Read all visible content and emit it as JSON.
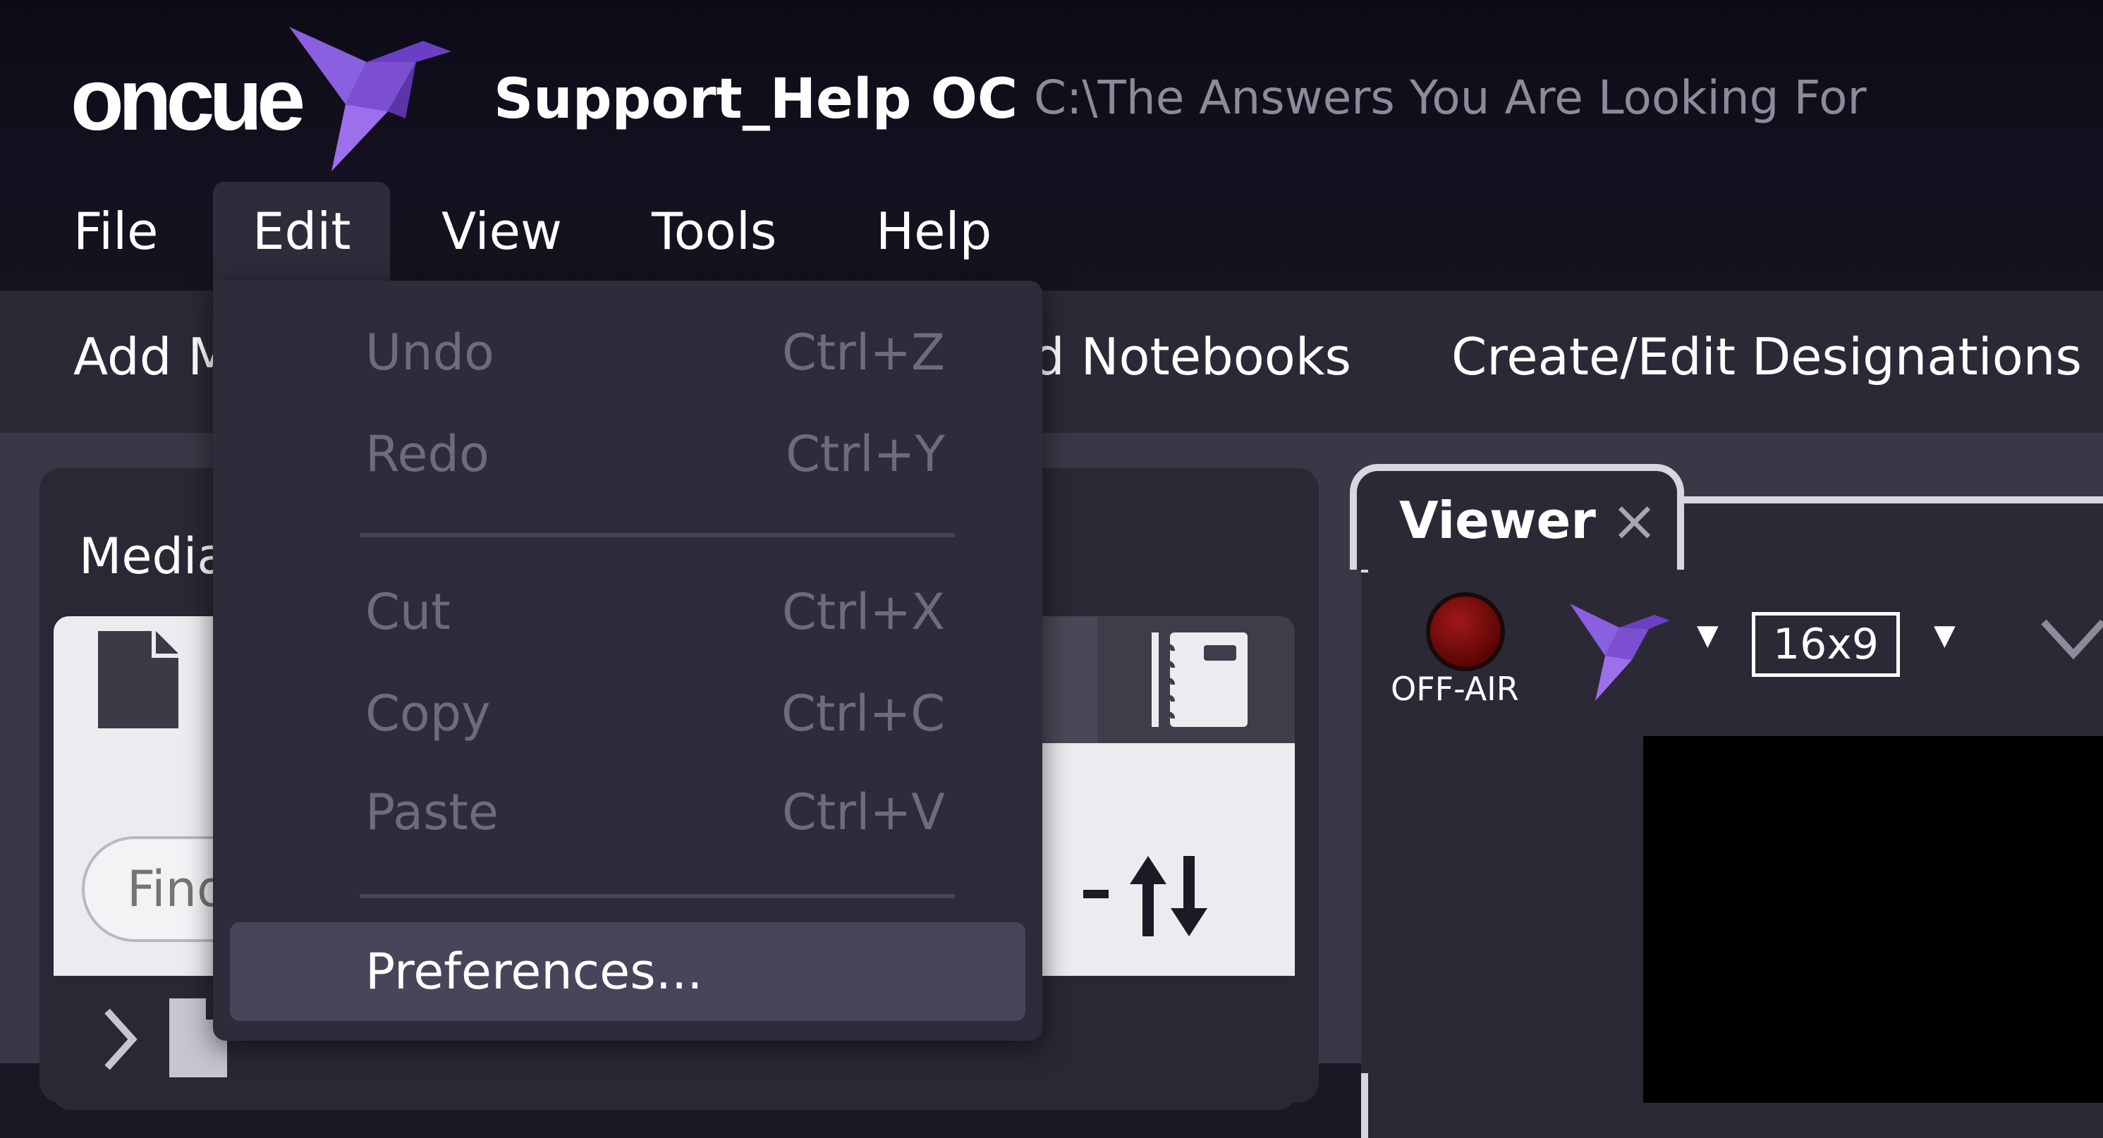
{
  "app": {
    "logo_text": "oncue",
    "title": "Support_Help OC",
    "path": "C:\\The Answers You Are Looking For"
  },
  "menubar": {
    "items": [
      {
        "label": "File"
      },
      {
        "label": "Edit"
      },
      {
        "label": "View"
      },
      {
        "label": "Tools"
      },
      {
        "label": "Help"
      }
    ],
    "active": "Edit"
  },
  "toolbar": {
    "add_media_partial": "Add M",
    "notebooks_partial": "d Notebooks",
    "designations": "Create/Edit Designations"
  },
  "media_panel": {
    "tab_partial": "Media",
    "search_placeholder": "Find"
  },
  "viewer": {
    "title": "Viewer",
    "close_glyph": "×",
    "status": "OFF-AIR",
    "aspect": "16x9"
  },
  "edit_menu": {
    "undo": {
      "label": "Undo",
      "shortcut": "Ctrl+Z",
      "enabled": false
    },
    "redo": {
      "label": "Redo",
      "shortcut": "Ctrl+Y",
      "enabled": false
    },
    "cut": {
      "label": "Cut",
      "shortcut": "Ctrl+X",
      "enabled": false
    },
    "copy": {
      "label": "Copy",
      "shortcut": "Ctrl+C",
      "enabled": false
    },
    "paste": {
      "label": "Paste",
      "shortcut": "Ctrl+V",
      "enabled": false
    },
    "preferences": {
      "label": "Preferences...",
      "enabled": true
    }
  },
  "colors": {
    "accent": "#7b4fd0",
    "background": "#1a1824",
    "menu_bg": "#2e2c3b",
    "disabled_text": "#6e6c79"
  }
}
